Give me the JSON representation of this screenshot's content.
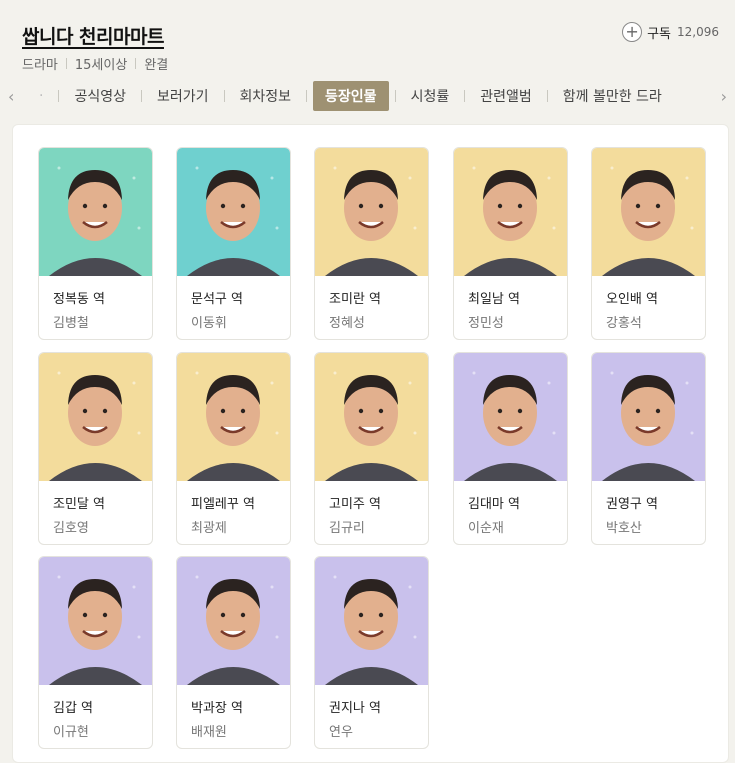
{
  "header": {
    "title": "쌉니다 천리마마트",
    "meta": [
      "드라마",
      "15세이상",
      "완결"
    ],
    "subscribe_label": "구독",
    "subscribe_count": "12,096"
  },
  "tabs": [
    {
      "label": "공식영상",
      "active": false
    },
    {
      "label": "보러가기",
      "active": false
    },
    {
      "label": "회차정보",
      "active": false
    },
    {
      "label": "등장인물",
      "active": true
    },
    {
      "label": "시청률",
      "active": false
    },
    {
      "label": "관련앨범",
      "active": false
    },
    {
      "label": "함께 볼만한 드라",
      "active": false
    }
  ],
  "cast": [
    {
      "role": "정복동 역",
      "actor": "김병철",
      "bg": "#7ed6c0"
    },
    {
      "role": "문석구 역",
      "actor": "이동휘",
      "bg": "#6fd0cf"
    },
    {
      "role": "조미란 역",
      "actor": "정혜성",
      "bg": "#f3dc9c"
    },
    {
      "role": "최일남 역",
      "actor": "정민성",
      "bg": "#f3dc9c"
    },
    {
      "role": "오인배 역",
      "actor": "강홍석",
      "bg": "#f3dc9c"
    },
    {
      "role": "조민달 역",
      "actor": "김호영",
      "bg": "#f3dc9c"
    },
    {
      "role": "피엘레꾸 역",
      "actor": "최광제",
      "bg": "#f3dc9c"
    },
    {
      "role": "고미주 역",
      "actor": "김규리",
      "bg": "#f3dc9c"
    },
    {
      "role": "김대마 역",
      "actor": "이순재",
      "bg": "#c9c1ec"
    },
    {
      "role": "권영구 역",
      "actor": "박호산",
      "bg": "#c9c1ec"
    },
    {
      "role": "김갑 역",
      "actor": "이규현",
      "bg": "#c9c1ec"
    },
    {
      "role": "박과장 역",
      "actor": "배재원",
      "bg": "#c9c1ec"
    },
    {
      "role": "권지나 역",
      "actor": "연우",
      "bg": "#c9c1ec"
    }
  ],
  "colors": {
    "active_tab": "#9e9172",
    "background": "#f3f2ed"
  }
}
